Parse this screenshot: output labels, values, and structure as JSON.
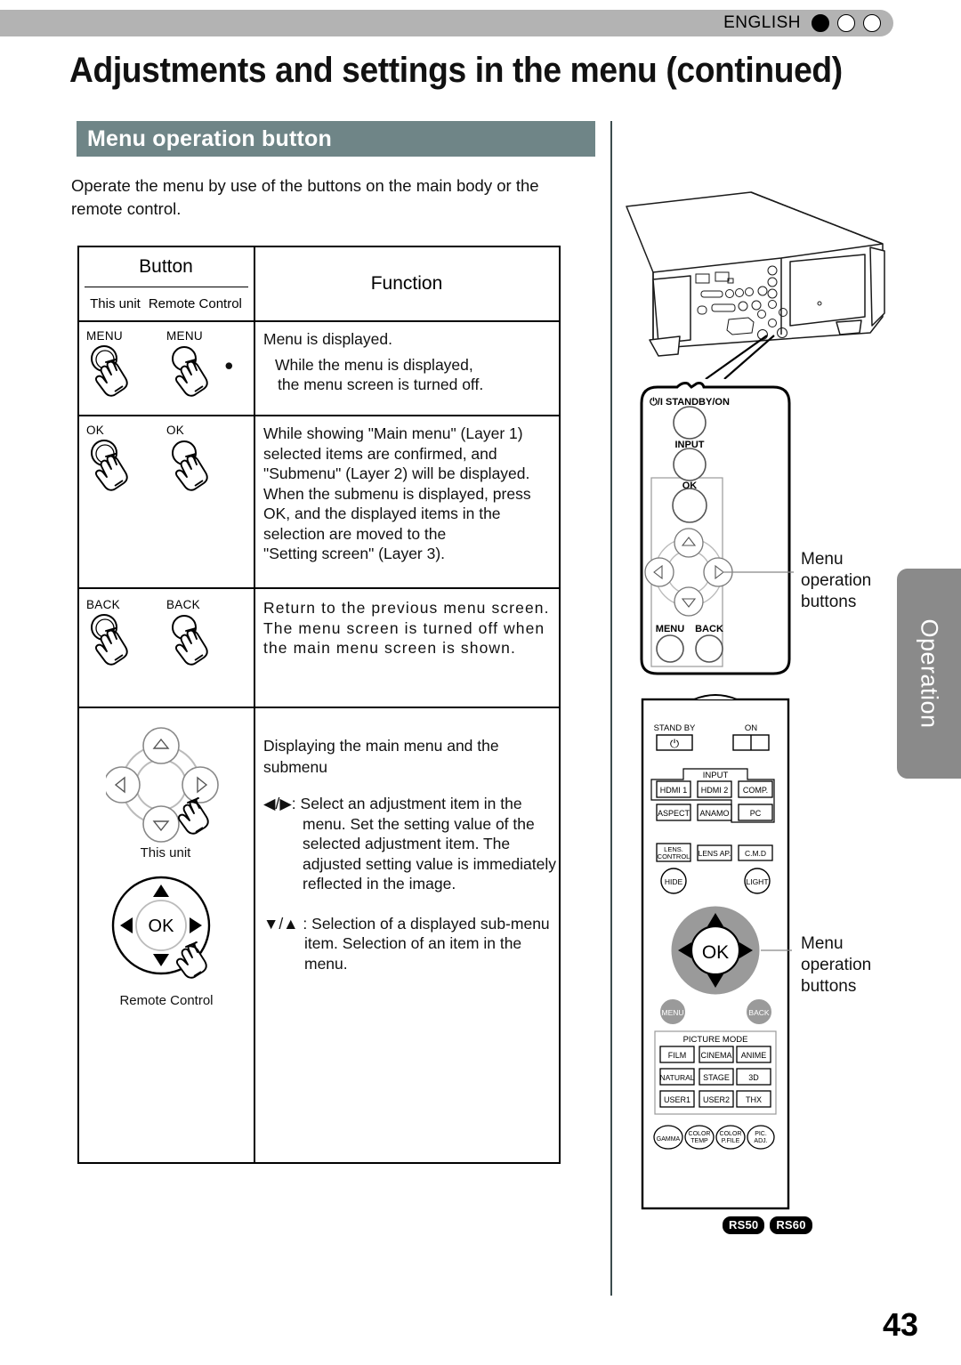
{
  "header": {
    "language": "ENGLISH",
    "indicators": [
      "filled",
      "hollow",
      "hollow"
    ]
  },
  "page_title": "Adjustments and settings in the menu (continued)",
  "section_heading": "Menu operation button",
  "intro": "Operate the menu by use of the buttons on the main body or the remote control.",
  "table": {
    "headers": {
      "button": "Button",
      "this_unit": "This unit",
      "remote_control": "Remote Control",
      "function": "Function"
    },
    "rows": [
      {
        "unit_label": "MENU",
        "remote_label": "MENU",
        "function_lines": [
          "Menu is displayed.",
          "While the menu is displayed,",
          "the menu screen is turned off."
        ]
      },
      {
        "unit_label": "OK",
        "remote_label": "OK",
        "function_lines": [
          "While showing \"Main menu\" (Layer 1)",
          "selected items are confirmed, and",
          "\"Submenu\" (Layer 2) will be displayed.",
          "When the submenu is displayed, press",
          "OK, and the displayed items in the",
          "selection are moved to the",
          "\"Setting screen\" (Layer 3)."
        ]
      },
      {
        "unit_label": "BACK",
        "remote_label": "BACK",
        "function_lines": [
          "Return to the previous menu screen.",
          "The menu screen is turned off when",
          "the main menu screen is shown."
        ]
      },
      {
        "unit_caption": "This unit",
        "remote_caption": "Remote Control",
        "remote_ok_label": "OK",
        "function_heading": "Displaying the main menu and the submenu",
        "bullets": [
          {
            "keys": "◀/▶",
            "colon": ":",
            "text": "Select an adjustment item in the menu. Set the setting value of the selected adjustment item. The adjusted setting value is immediately reflected in the image."
          },
          {
            "keys": "▼/▲",
            "colon": ":",
            "text": "Selection of a displayed sub-menu item. Selection of an item in the menu."
          }
        ]
      }
    ]
  },
  "control_panel": {
    "standby_on": "⏻/I STANDBY/ON",
    "input": "INPUT",
    "ok": "OK",
    "menu": "MENU",
    "back": "BACK",
    "callout": "Menu\noperation\nbuttons",
    "callout_lines": [
      "Menu",
      "operation",
      "buttons"
    ]
  },
  "remote": {
    "standby": "STAND BY",
    "on": "ON",
    "input_group": "INPUT",
    "input_buttons": [
      "HDMI 1",
      "HDMI 2",
      "COMP."
    ],
    "aspect_row": [
      "ASPECT",
      "ANAMO",
      "PC"
    ],
    "lens_row": [
      "LENS.\nCONTROL",
      "LENS AP.",
      "C.M.D"
    ],
    "lens_control_l1": "LENS.",
    "lens_control_l2": "CONTROL",
    "lens_ap": "LENS AP.",
    "cmd": "C.M.D",
    "hide": "HIDE",
    "light": "LIGHT",
    "ok": "OK",
    "menu": "MENU",
    "back": "BACK",
    "picture_mode_title": "PICTURE MODE",
    "picture_modes": [
      "FILM",
      "CINEMA",
      "ANIME",
      "NATURAL",
      "STAGE",
      "3D",
      "USER1",
      "USER2",
      "THX"
    ],
    "bottom_round": [
      {
        "l1": "GAMMA",
        "l2": ""
      },
      {
        "l1": "COLOR",
        "l2": "TEMP"
      },
      {
        "l1": "COLOR",
        "l2": "P.FILE"
      },
      {
        "l1": "PIC.",
        "l2": "ADJ."
      }
    ],
    "callout_lines": [
      "Menu",
      "operation",
      "buttons"
    ]
  },
  "badges": [
    "RS50",
    "RS60"
  ],
  "side_tab": "Operation",
  "page_number": "43",
  "colors": {
    "section_bar": "#6f8587",
    "lang_bar": "#b3b3b3",
    "side_tab": "#8a8a8a",
    "divider": "#3c4c4e",
    "dpad_gray": "#9a9a9a"
  }
}
